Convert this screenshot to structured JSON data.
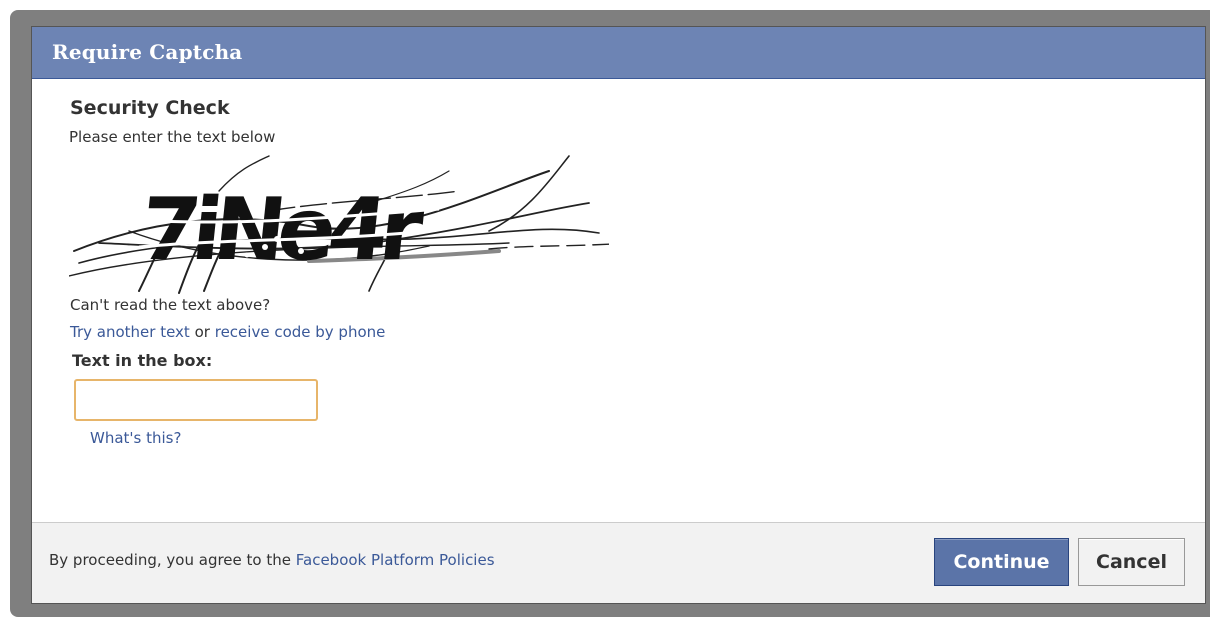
{
  "dialog": {
    "title": "Require Captcha"
  },
  "security": {
    "heading": "Security Check",
    "instruction": "Please enter the text below",
    "captcha_text": "7iNe4r",
    "cant_read": "Can't read the text above?",
    "try_another": "Try another text",
    "or": "or",
    "receive_by_phone": "receive code by phone",
    "input_label": "Text in the box:",
    "input_value": "",
    "whats_this": "What's this?"
  },
  "footer": {
    "agreement_prefix": "By proceeding, you agree to the",
    "policy_link": "Facebook Platform Policies",
    "continue_label": "Continue",
    "cancel_label": "Cancel"
  },
  "colors": {
    "titlebar": "#6d84b4",
    "link": "#3b5998",
    "continue_button": "#5b74a8",
    "input_focus_border": "#e7b56a"
  }
}
